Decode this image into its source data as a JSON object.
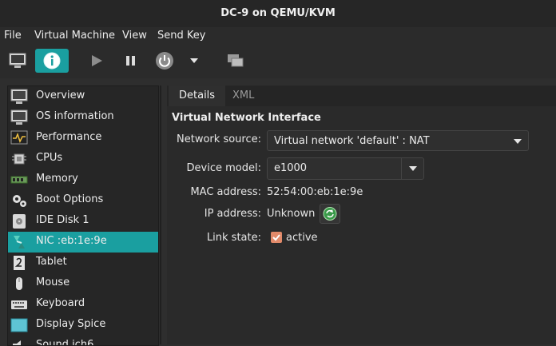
{
  "window": {
    "title": "DC-9 on QEMU/KVM"
  },
  "menu": {
    "file": "File",
    "vm": "Virtual Machine",
    "view": "View",
    "sendkey": "Send Key"
  },
  "toolbar": {
    "console": "monitor-icon",
    "details": "info-icon",
    "run": "play-icon",
    "pause": "pause-icon",
    "shutdown": "power-icon",
    "shutdown_menu": "chevron-down-icon",
    "snapshots": "snapshot-icon"
  },
  "sidebar": {
    "items": [
      {
        "label": "Overview",
        "icon": "monitor-icon"
      },
      {
        "label": "OS information",
        "icon": "monitor-icon"
      },
      {
        "label": "Performance",
        "icon": "performance-icon"
      },
      {
        "label": "CPUs",
        "icon": "cpu-icon"
      },
      {
        "label": "Memory",
        "icon": "memory-icon"
      },
      {
        "label": "Boot Options",
        "icon": "gears-icon"
      },
      {
        "label": "IDE Disk 1",
        "icon": "disk-icon"
      },
      {
        "label": "NIC :eb:1e:9e",
        "icon": "nic-icon",
        "selected": true
      },
      {
        "label": "Tablet",
        "icon": "tablet-icon"
      },
      {
        "label": "Mouse",
        "icon": "mouse-icon"
      },
      {
        "label": "Keyboard",
        "icon": "keyboard-icon"
      },
      {
        "label": "Display Spice",
        "icon": "display-icon"
      },
      {
        "label": "Sound ich6",
        "icon": "sound-icon"
      }
    ]
  },
  "tabs": {
    "details": "Details",
    "xml": "XML"
  },
  "nic": {
    "section_title": "Virtual Network Interface",
    "network_source_label": "Network source:",
    "network_source_value": "Virtual network 'default' : NAT",
    "device_model_label": "Device model:",
    "device_model_value": "e1000",
    "mac_label": "MAC address:",
    "mac_value": "52:54:00:eb:1e:9e",
    "ip_label": "IP address:",
    "ip_value": "Unknown",
    "link_label": "Link state:",
    "link_value": "active",
    "link_checked": true
  },
  "colors": {
    "accent": "#1a9fa0",
    "checkbox": "#e28a6a",
    "background": "#2e2e2e"
  }
}
